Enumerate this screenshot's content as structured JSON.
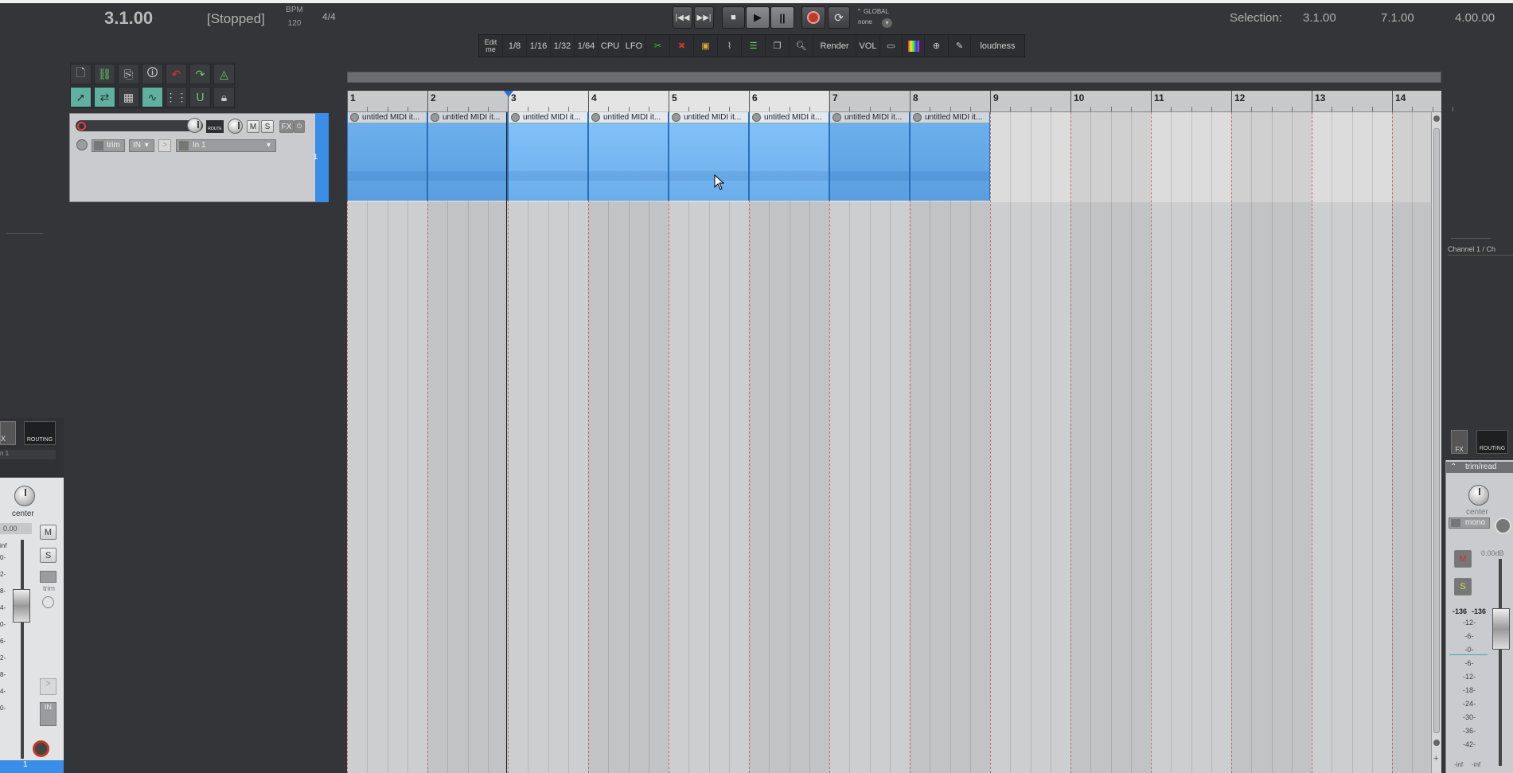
{
  "transport": {
    "position": "3.1.00",
    "state": "[Stopped]",
    "bpm_label": "BPM",
    "bpm_value": "120",
    "time_sig": "4/4",
    "automation_label": "GLOBAL",
    "automation_value": "none"
  },
  "selection": {
    "label": "Selection:",
    "start": "3.1.00",
    "end": "7.1.00",
    "length": "4.00.00"
  },
  "toolbar2": {
    "items": [
      "Edit me",
      "1/8",
      "1/16",
      "1/32",
      "1/64",
      "CPU",
      "LFO",
      "Render",
      "VOL",
      "loudness"
    ]
  },
  "track": {
    "number": "1",
    "trim_label": "trim",
    "input_label": "IN",
    "input_value": "In 1",
    "mute": "M",
    "solo": "S",
    "fx": "FX",
    "route": "ROUTE"
  },
  "ruler": {
    "bars": [
      "1",
      "2",
      "3",
      "4",
      "5",
      "6",
      "7",
      "8",
      "9",
      "10",
      "11",
      "12",
      "13",
      "14"
    ]
  },
  "items": {
    "label": "untitled MIDI it..."
  },
  "left_mixer": {
    "fx": "X",
    "routing": "ROUTING",
    "input": "n 1",
    "pan": "center",
    "volume": "0.00",
    "inf": "inf",
    "mute": "M",
    "solo": "S",
    "trim": "trim",
    "in": "IN",
    "track_number": "1",
    "scale": [
      "0-",
      "2-",
      "8-",
      "4-",
      "0-",
      "6-",
      "2-",
      "8-",
      "4-",
      "0-"
    ]
  },
  "right_mixer": {
    "channel_label": "Channel 1 / Ch",
    "fx": "FX",
    "routing": "ROUTING",
    "automation": "trim/read",
    "pan": "center",
    "mono": "mono",
    "volume": "0.00dB",
    "mute": "M",
    "solo": "S",
    "peak_l": "-136",
    "peak_r": "-136",
    "scale": [
      "-12-",
      "-6-",
      "-0-",
      "-6-",
      "-12-",
      "-18-",
      "-24-",
      "-30-",
      "-36-",
      "-42-"
    ],
    "inf_l": "-inf",
    "inf_r": "-inf"
  }
}
